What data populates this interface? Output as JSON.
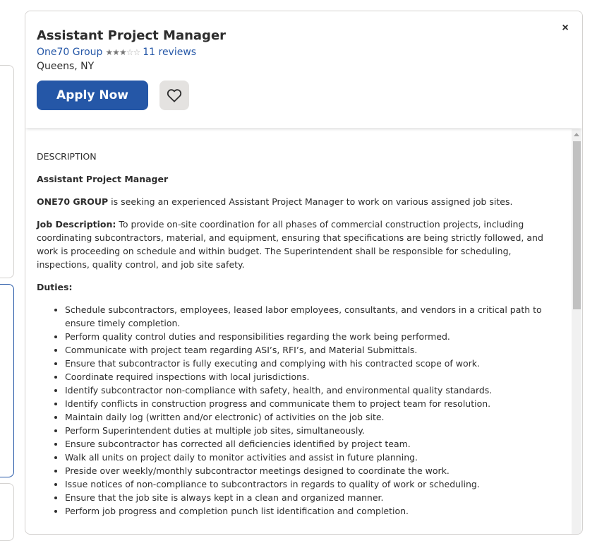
{
  "job": {
    "title": "Assistant Project Manager",
    "company": "One70 Group",
    "rating": 3,
    "rating_max": 5,
    "reviews": "11 reviews",
    "location": "Queens, NY",
    "apply_label": "Apply Now",
    "close_glyph": "×"
  },
  "description": {
    "label": "DESCRIPTION",
    "heading": "Assistant Project Manager",
    "intro_bold": "ONE70 GROUP",
    "intro_rest": " is seeking an experienced Assistant Project Manager to work on various assigned job sites.",
    "jobdesc_bold": "Job Description:",
    "jobdesc_rest": " To provide on-site coordination for all phases of commercial construction projects, including coordinating subcontractors, material, and equipment, ensuring that specifications are being strictly followed, and work is proceeding on schedule and within budget. The Superintendent shall be responsible for scheduling, inspections, quality control, and job site safety.",
    "duties_label": "Duties:",
    "duties": [
      "Schedule subcontractors, employees, leased labor employees, consultants, and vendors in a critical path to ensure timely completion.",
      "Perform quality control duties and responsibilities regarding the work being performed.",
      "Communicate with project team regarding ASI’s, RFI’s, and Material Submittals.",
      "Ensure that subcontractor is fully executing and complying with his contracted scope of work.",
      "Coordinate required inspections with local jurisdictions.",
      "Identify subcontractor non-compliance with safety, health, and environmental quality standards.",
      "Identify conflicts in construction progress and communicate them to project team for resolution.",
      "Maintain daily log (written and/or electronic) of activities on the job site.",
      "Perform Superintendent duties at multiple job sites, simultaneously.",
      "Ensure subcontractor has corrected all deficiencies identified by project team.",
      "Walk all units on project daily to monitor activities and assist in future planning.",
      "Preside over weekly/monthly subcontractor meetings designed to coordinate the work.",
      "Issue notices of non-compliance to subcontractors in regards to quality of work or scheduling.",
      "Ensure that the job site is always kept in a clean and organized manner.",
      "Perform job progress and completion punch list identification and completion."
    ]
  },
  "colors": {
    "accent": "#2557a7",
    "save_bg": "#e4e2e0",
    "text": "#2d2d2d"
  }
}
